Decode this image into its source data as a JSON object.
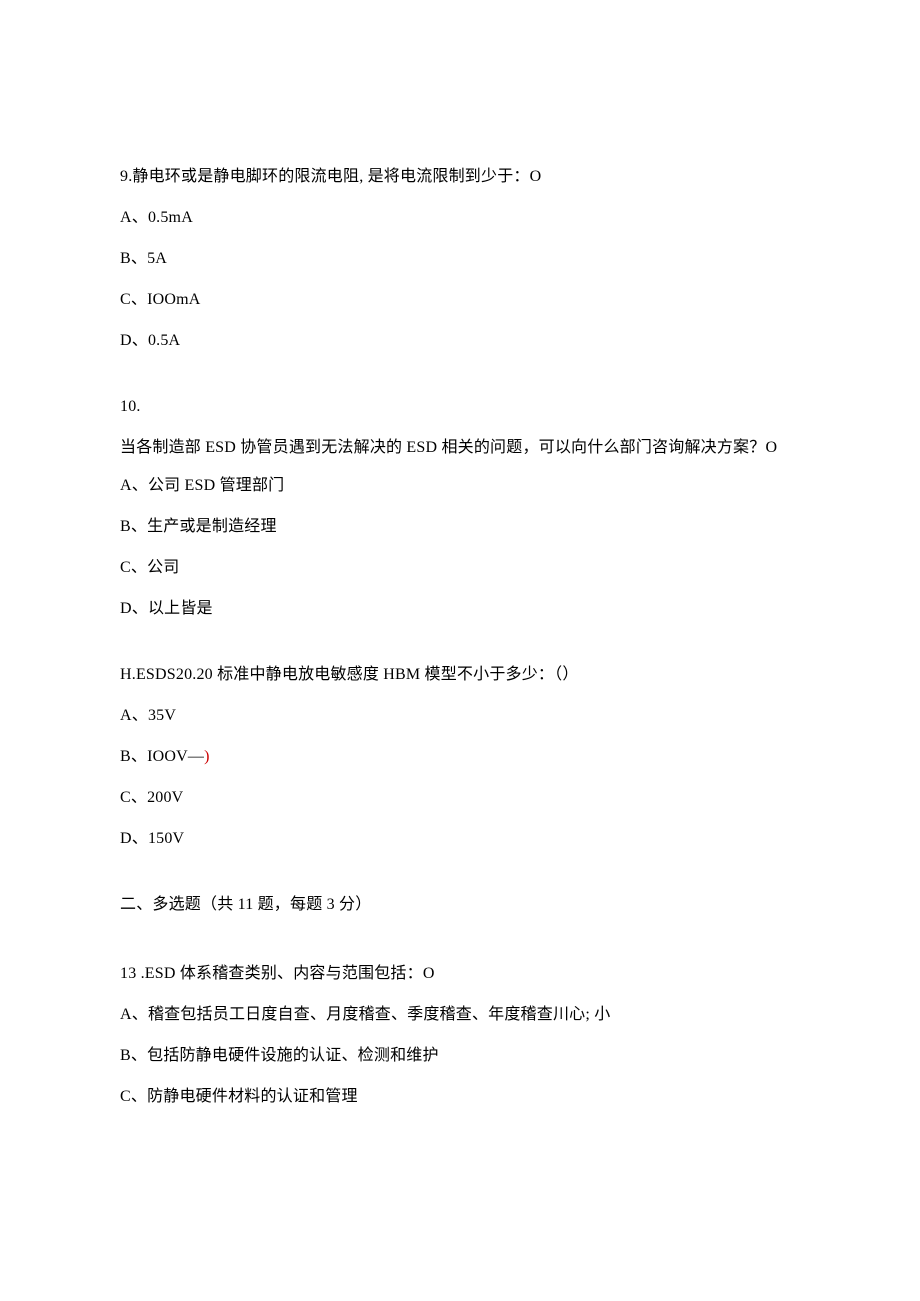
{
  "q9": {
    "stem": "9.静电环或是静电脚环的限流电阻, 是将电流限制到少于：O",
    "optA": "A、0.5mA",
    "optB": "B、5A",
    "optC": "C、IOOmA",
    "optD": "D、0.5A"
  },
  "q10": {
    "num": "10.",
    "stem": "当各制造部 ESD 协管员遇到无法解决的 ESD 相关的问题，可以向什么部门咨询解决方案？O",
    "optA": "A、公司 ESD 管理部门",
    "optB": "B、生产或是制造经理",
    "optC": "C、公司",
    "optD": "D、以上皆是"
  },
  "q11": {
    "stem": "H.ESDS20.20 标准中静电放电敏感度 HBM 模型不小于多少：（）",
    "optA": "A、35V",
    "optB_prefix": "B、IOOV—",
    "optB_paren": ")",
    "optC": "C、200V",
    "optD": "D、150V"
  },
  "sec2": {
    "heading": "二、多选题（共 11 题，每题 3 分）"
  },
  "q13": {
    "stem": "13 .ESD 体系稽查类别、内容与范围包括：O",
    "optA": "A、稽查包括员工日度自查、月度稽查、季度稽查、年度稽查川心; 小",
    "optB": "B、包括防静电硬件设施的认证、检测和维护",
    "optC": "C、防静电硬件材料的认证和管理"
  }
}
